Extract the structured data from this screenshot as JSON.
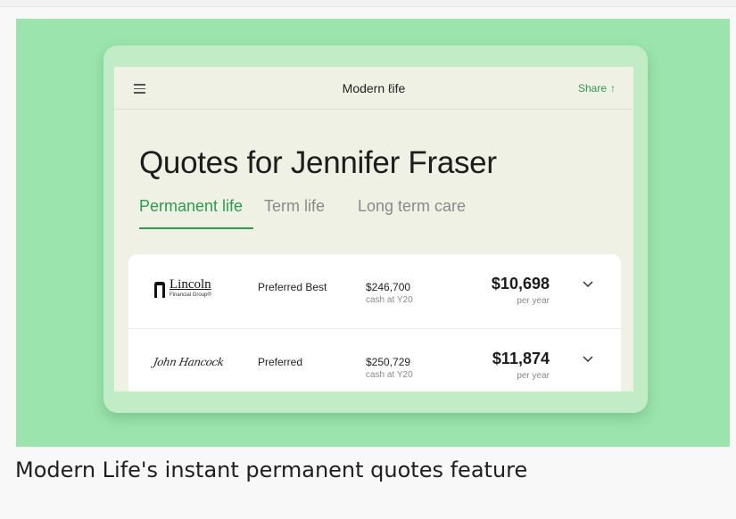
{
  "app": {
    "brand": "Modern ℓife",
    "share_label": "Share",
    "share_icon": "share-icon",
    "menu_icon": "menu-icon"
  },
  "page": {
    "title": "Quotes for Jennifer Fraser"
  },
  "tabs": [
    {
      "label": "Permanent life",
      "active": true
    },
    {
      "label": "Term life",
      "active": false
    },
    {
      "label": "Long term care",
      "active": false
    }
  ],
  "quotes": [
    {
      "carrier": "Lincoln",
      "carrier_sub": "Financial Group®",
      "rating": "Preferred Best",
      "cash_value": "$246,700",
      "cash_label": "cash at Y20",
      "premium": "$10,698",
      "premium_label": "per year"
    },
    {
      "carrier": "John Hancock",
      "rating": "Preferred",
      "cash_value": "$250,729",
      "cash_label": "cash at Y20",
      "premium": "$11,874",
      "premium_label": "per year"
    }
  ],
  "caption": "Modern Life's instant permanent quotes feature",
  "colors": {
    "background": "#9be4ad",
    "accent": "#2e9a4e",
    "screen": "#eef1e3"
  }
}
